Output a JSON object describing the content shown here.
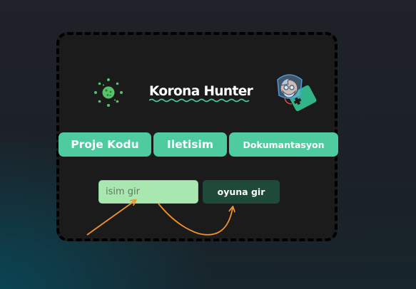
{
  "header": {
    "title": "Korona Hunter",
    "logo_icon": "virus-icon",
    "mascot_icon": "doctor-avatar-icon"
  },
  "nav": {
    "tabs": [
      {
        "label": "Proje Kodu"
      },
      {
        "label": "Iletisim"
      },
      {
        "label": "Dokumantasyon"
      }
    ]
  },
  "form": {
    "name_placeholder": "isim gir",
    "name_value": "",
    "play_label": "oyuna gir"
  },
  "colors": {
    "accent": "#4ecb9f",
    "input_bg": "#a9e7b1",
    "button_dark": "#1f4a3a",
    "arrow": "#f0922e",
    "card_bg": "#1b1b1b"
  }
}
